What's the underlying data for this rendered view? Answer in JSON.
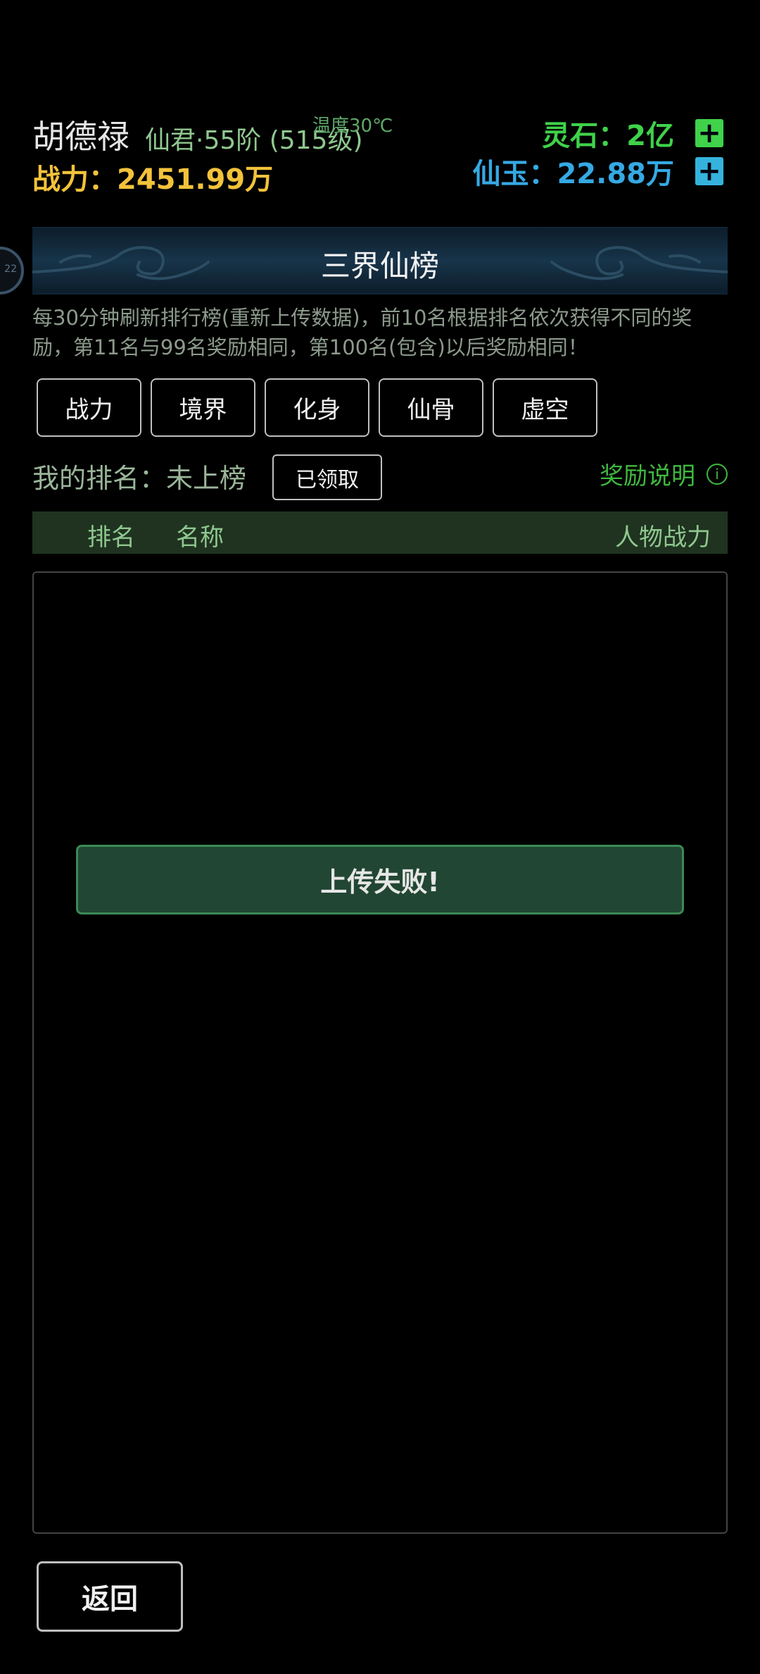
{
  "header": {
    "player_name": "胡德禄",
    "player_rank": "仙君·55阶 (515级)",
    "temperature": "温度30℃",
    "power": "战力：2451.99万",
    "spirit_stone": "灵石：2亿",
    "immortal_jade": "仙玉：22.88万",
    "plus_symbol": "+"
  },
  "side_tab": {
    "label": "22"
  },
  "banner": {
    "title": "三界仙榜"
  },
  "notice": "每30分钟刷新排行榜(重新上传数据)，前10名根据排名依次获得不同的奖励，第11名与99名奖励相同，第100名(包含)以后奖励相同！",
  "tabs": [
    "战力",
    "境界",
    "化身",
    "仙骨",
    "虚空"
  ],
  "my_rank": {
    "label": "我的排名：未上榜",
    "claimed_button": "已领取",
    "reward_info": "奖励说明",
    "info_icon": "i"
  },
  "table": {
    "col_rank": "排名",
    "col_name": "名称",
    "col_power": "人物战力"
  },
  "toast": "上传失败!",
  "back_button": "返回",
  "colors": {
    "power_gold": "#f2c23a",
    "stone_green": "#3fd24a",
    "jade_blue": "#35a9e4",
    "header_bar_green": "#1f3320",
    "toast_green": "#214633"
  },
  "icons": {
    "plus": "plus-icon",
    "info": "info-icon",
    "cloud": "cloud-ornament-icon"
  }
}
